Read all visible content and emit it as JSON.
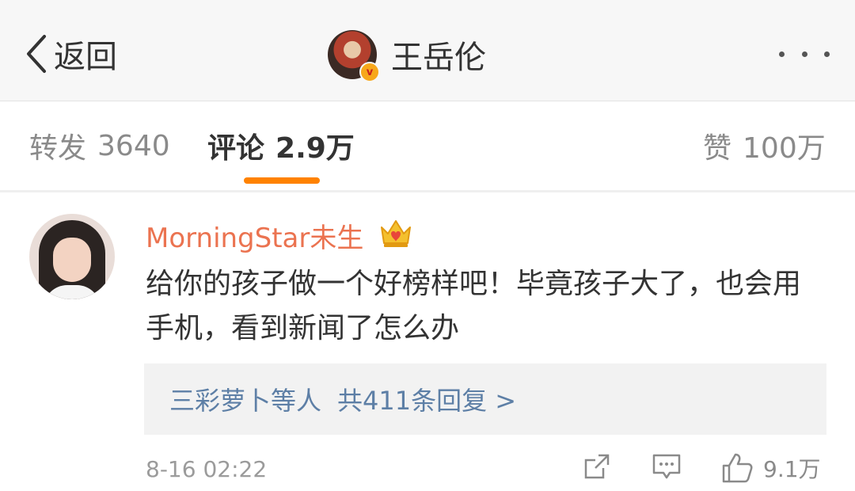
{
  "header": {
    "back_label": "返回",
    "profile_name": "王岳伦",
    "verified_badge": "v",
    "more_icon": "more-dots-icon"
  },
  "tabs": {
    "repost_label": "转发",
    "repost_count": "3640",
    "comment_label": "评论",
    "comment_count": "2.9万",
    "like_label": "赞",
    "like_count": "100万",
    "active_color": "#ff8200"
  },
  "comment": {
    "username": "MorningStar未生",
    "text": "给你的孩子做一个好榜样吧！毕竟孩子大了，也会用手机，看到新闻了怎么办",
    "replies_names": "三彩萝卜等人",
    "replies_count_text": "共411条回复 >",
    "timestamp": "8-16 02:22",
    "like_count": "9.1万",
    "username_color": "#eb7350",
    "link_color": "#5d7fa6"
  }
}
